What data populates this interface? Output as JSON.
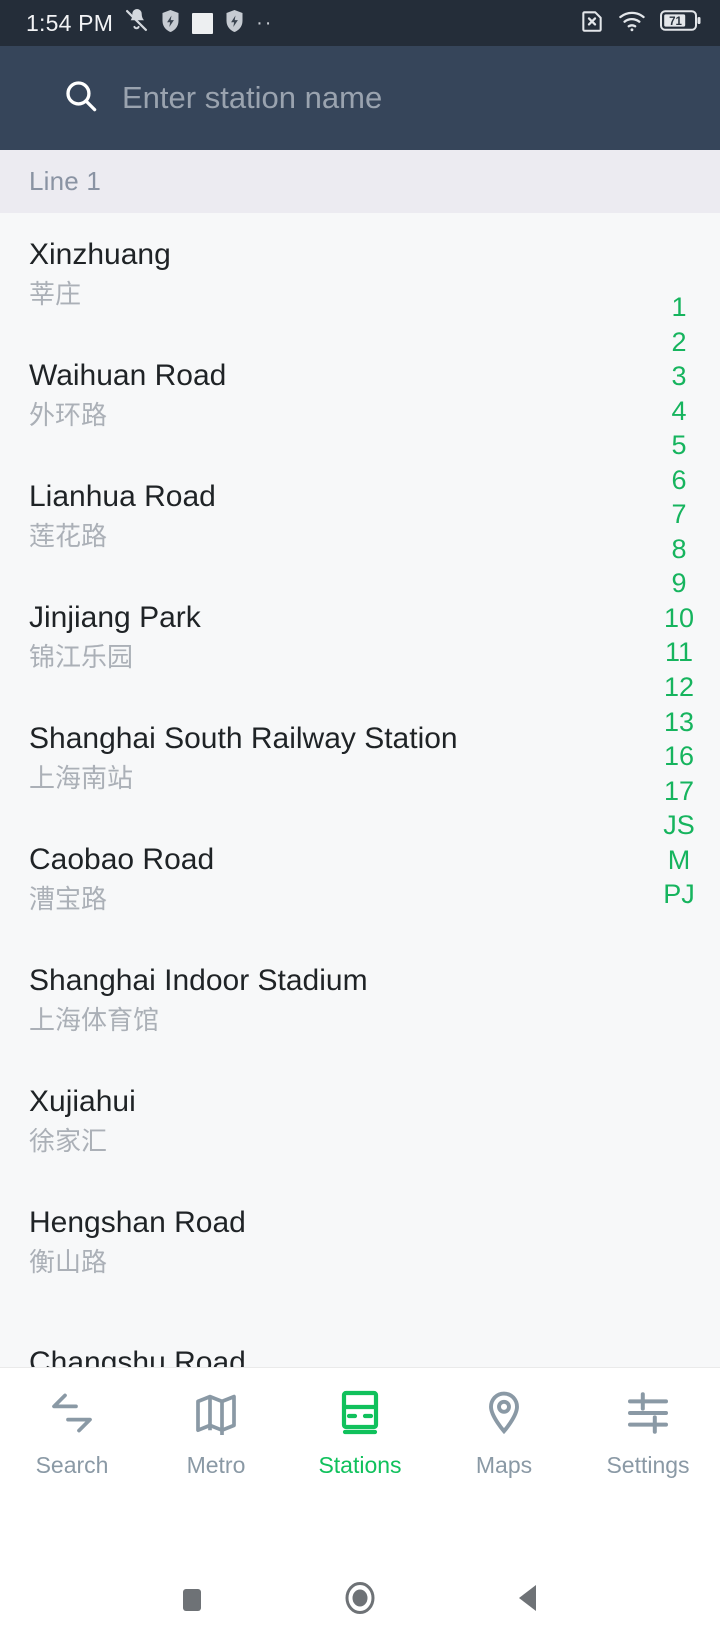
{
  "status_bar": {
    "time": "1:54 PM",
    "icons_left": [
      "bell-muted-icon",
      "shield-icon",
      "white-square-icon",
      "shield-icon",
      "dots-icon"
    ],
    "icons_right": [
      "sim-card-off-icon",
      "wifi-icon",
      "battery-icon"
    ],
    "battery_level": "71",
    "background": "#242D39"
  },
  "search": {
    "placeholder": "Enter station name",
    "value": "",
    "icon": "search-icon",
    "background": "#36455A"
  },
  "section": {
    "label": "Line 1",
    "background": "#ECEBF1"
  },
  "stations": [
    {
      "en": "Xinzhuang",
      "zh": "莘庄"
    },
    {
      "en": "Waihuan Road",
      "zh": "外环路"
    },
    {
      "en": "Lianhua Road",
      "zh": "莲花路"
    },
    {
      "en": "Jinjiang Park",
      "zh": "锦江乐园"
    },
    {
      "en": "Shanghai South Railway Station",
      "zh": "上海南站"
    },
    {
      "en": "Caobao Road",
      "zh": "漕宝路"
    },
    {
      "en": "Shanghai Indoor Stadium",
      "zh": "上海体育馆"
    },
    {
      "en": "Xujiahui",
      "zh": "徐家汇"
    },
    {
      "en": "Hengshan Road",
      "zh": "衡山路"
    },
    {
      "en": "Changshu Road",
      "zh": ""
    }
  ],
  "index_bar": {
    "color": "#16B45E",
    "items": [
      "1",
      "2",
      "3",
      "4",
      "5",
      "6",
      "7",
      "8",
      "9",
      "10",
      "11",
      "12",
      "13",
      "16",
      "17",
      "JS",
      "M",
      "PJ"
    ]
  },
  "bottom_nav": {
    "active_color": "#10C15C",
    "inactive_color": "#8A99A5",
    "items": [
      {
        "label": "Search",
        "icon": "transfer-arrows-icon",
        "active": false
      },
      {
        "label": "Metro",
        "icon": "folded-map-icon",
        "active": false
      },
      {
        "label": "Stations",
        "icon": "train-car-icon",
        "active": true
      },
      {
        "label": "Maps",
        "icon": "location-pin-icon",
        "active": false
      },
      {
        "label": "Settings",
        "icon": "sliders-icon",
        "active": false
      }
    ]
  },
  "android_nav": {
    "buttons": [
      {
        "name": "recents-square-icon"
      },
      {
        "name": "home-circle-icon"
      },
      {
        "name": "back-triangle-icon"
      }
    ]
  }
}
